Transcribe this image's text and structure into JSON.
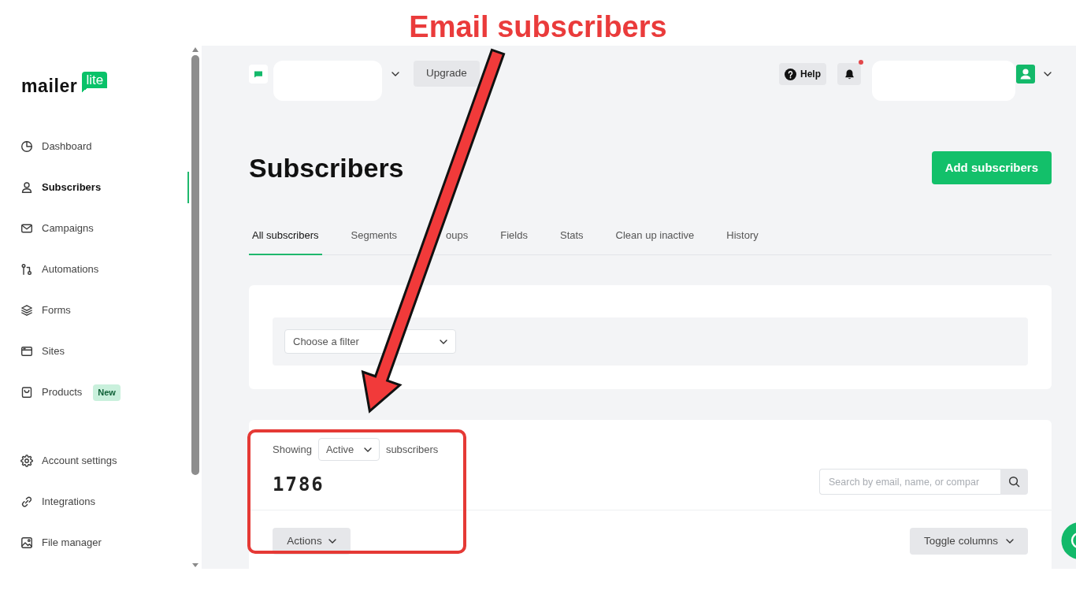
{
  "annotation": {
    "title": "Email subscribers"
  },
  "sidebar": {
    "logo": {
      "wordmark": "mailer",
      "tag": "lite"
    },
    "main_items": [
      {
        "label": "Dashboard",
        "selected": false
      },
      {
        "label": "Subscribers",
        "selected": true
      },
      {
        "label": "Campaigns",
        "selected": false
      },
      {
        "label": "Automations",
        "selected": false
      },
      {
        "label": "Forms",
        "selected": false
      },
      {
        "label": "Sites",
        "selected": false
      },
      {
        "label": "Products",
        "selected": false,
        "badge": "New"
      }
    ],
    "settings_items": [
      {
        "label": "Account settings",
        "selected": false
      },
      {
        "label": "Integrations",
        "selected": false
      },
      {
        "label": "File manager",
        "selected": false
      }
    ]
  },
  "topbar": {
    "upgrade_button": "Upgrade",
    "help_button": "Help",
    "has_unread_notifications": true
  },
  "page": {
    "title": "Subscribers",
    "primary_button": "Add subscribers"
  },
  "tabs": [
    {
      "label": "All subscribers",
      "selected": true
    },
    {
      "label": "Segments",
      "selected": false
    },
    {
      "label": "oups",
      "selected": false
    },
    {
      "label": "Fields",
      "selected": false
    },
    {
      "label": "Stats",
      "selected": false
    },
    {
      "label": "Clean up inactive",
      "selected": false
    },
    {
      "label": "History",
      "selected": false
    }
  ],
  "filter": {
    "placeholder": "Choose a filter"
  },
  "subscriber_list": {
    "showing_label": "Showing",
    "status_select": "Active",
    "status_suffix": "subscribers",
    "count": "1786",
    "search": {
      "placeholder": "Search by email, name, or compar"
    },
    "actions_button": "Actions",
    "toggle_columns_button": "Toggle columns"
  }
}
